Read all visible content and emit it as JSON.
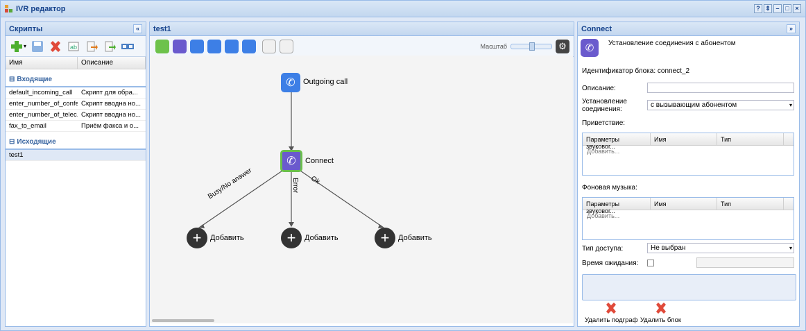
{
  "window": {
    "title": "IVR редактор",
    "buttons": [
      "?",
      "⇕",
      "–",
      "□",
      "×"
    ]
  },
  "scripts_panel": {
    "title": "Скрипты",
    "collapse": "«",
    "columns": [
      "Имя",
      "Описание"
    ],
    "groups": [
      {
        "name": "Входящие",
        "rows": [
          {
            "name": "default_incoming_call",
            "desc": "Скрипт для обра..."
          },
          {
            "name": "enter_number_of_confe...",
            "desc": "Скрипт вводна но..."
          },
          {
            "name": "enter_number_of_telec...",
            "desc": "Скрипт вводна но..."
          },
          {
            "name": "fax_to_email",
            "desc": "Приём факса и о..."
          }
        ]
      },
      {
        "name": "Исходящие",
        "rows": [
          {
            "name": "test1",
            "desc": ""
          }
        ]
      }
    ]
  },
  "editor": {
    "title": "test1",
    "scale_label": "Масштаб",
    "nodes": {
      "outgoing": "Outgoing call",
      "connect": "Connect",
      "add1": "Добавить",
      "add2": "Добавить",
      "add3": "Добавить"
    },
    "edges": {
      "busy": "Busy/No answer",
      "error": "Error",
      "ok": "Ok"
    }
  },
  "props_panel": {
    "title": "Connect",
    "collapse": "»",
    "header_text": "Установление соединения с абонентом",
    "block_id": "Идентификатор блока: connect_2",
    "description_label": "Описание:",
    "description_value": "",
    "connect_label_1": "Установление",
    "connect_label_2": "соединения:",
    "connect_value": "с вызывающим абонентом",
    "greeting_label": "Приветствие:",
    "grid_cols": [
      "Параметры звуковог...",
      "Имя",
      "Тип"
    ],
    "grid_add": "Добавить...",
    "music_label": "Фоновая музыка:",
    "access_label": "Тип доступа:",
    "access_value": "Не выбран",
    "timeout_label": "Время ожидания:",
    "delete_sub": "Удалить подграф",
    "delete_block": "Удалить блок"
  },
  "colors": {
    "accent": "#15428b",
    "node_purple": "#6a5acd",
    "node_blue": "#3d7fe6",
    "connect_border": "#6abf4b"
  }
}
